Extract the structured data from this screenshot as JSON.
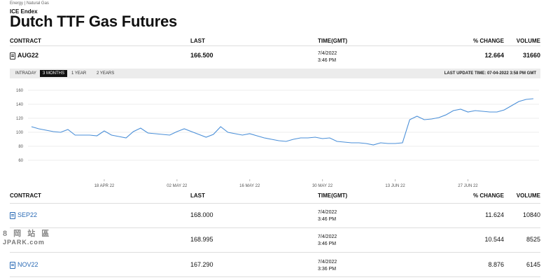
{
  "breadcrumb": "Energy | Natural Gas",
  "source": "ICE Endex",
  "title": "Dutch TTF Gas Futures",
  "columns": {
    "contract": "CONTRACT",
    "last": "LAST",
    "time": "TIME(GMT)",
    "change": "% CHANGE",
    "volume": "VOLUME"
  },
  "main_contract": {
    "name": "AUG22",
    "last": "166.500",
    "date": "7/4/2022",
    "time": "3:46 PM",
    "change": "12.664",
    "volume": "31660"
  },
  "tabs": [
    {
      "label": "INTRADAY",
      "active": false
    },
    {
      "label": "3 MONTHS",
      "active": true
    },
    {
      "label": "1 YEAR",
      "active": false
    },
    {
      "label": "2 YEARS",
      "active": false
    }
  ],
  "last_update": "LAST UPDATE TIME: 07-04-2022 3:58 PM GMT",
  "chart_data": {
    "type": "line",
    "ylim": [
      60,
      160
    ],
    "yticks": [
      60,
      80,
      100,
      120,
      140,
      160
    ],
    "xtick_labels": [
      "18 APR 22",
      "02 MAY 22",
      "16 MAY 22",
      "30 MAY 22",
      "13 JUN 22",
      "27 JUN 22"
    ],
    "xtick_idx": [
      10,
      20,
      30,
      40,
      50,
      60
    ],
    "series": [
      {
        "color": "#4a8fd8",
        "values": [
          108,
          105,
          103,
          101,
          100,
          104,
          96,
          96,
          96,
          95,
          102,
          96,
          94,
          92,
          101,
          106,
          99,
          98,
          97,
          96,
          101,
          105,
          101,
          97,
          93,
          97,
          108,
          100,
          98,
          96,
          98,
          95,
          92,
          90,
          88,
          87,
          90,
          92,
          92,
          93,
          91,
          92,
          87,
          86,
          85,
          85,
          84,
          82,
          85,
          84,
          84,
          85,
          118,
          123,
          118,
          119,
          121,
          125,
          131,
          133,
          129,
          131,
          130,
          129,
          129,
          132,
          138,
          144,
          147,
          148
        ]
      }
    ]
  },
  "table": {
    "rows": [
      {
        "name": "SEP22",
        "last": "168.000",
        "date": "7/4/2022",
        "time": "3:46 PM",
        "change": "11.624",
        "volume": "10840"
      },
      {
        "name": "",
        "last": "168.995",
        "date": "7/4/2022",
        "time": "3:46 PM",
        "change": "10.544",
        "volume": "8525"
      },
      {
        "name": "NOV22",
        "last": "167.290",
        "date": "7/4/2022",
        "time": "3:36 PM",
        "change": "8.876",
        "volume": "6145"
      }
    ]
  },
  "watermark": {
    "line1": "8 岡 站 區",
    "line2": "JPARK.com"
  },
  "icons": {
    "document": "document-icon"
  }
}
